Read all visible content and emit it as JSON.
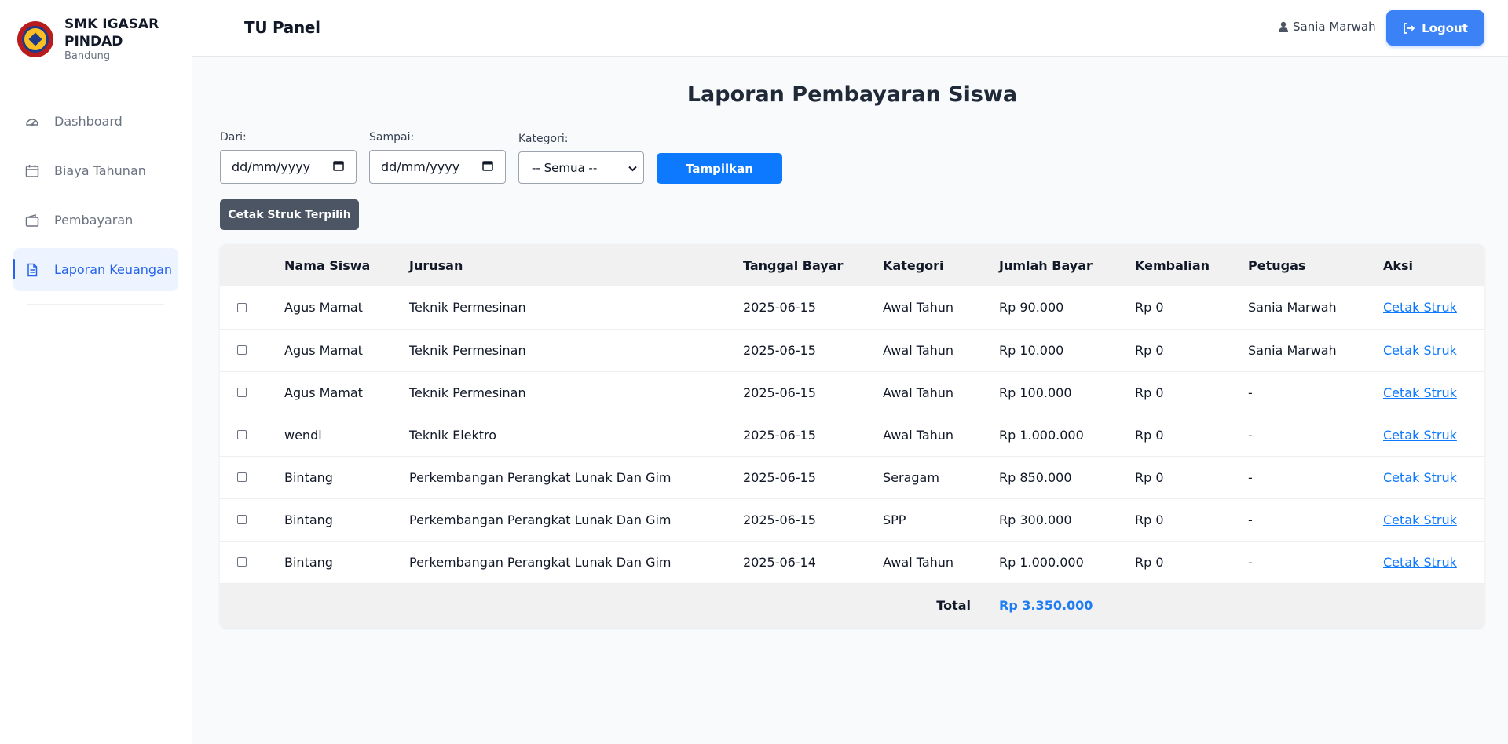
{
  "brand": {
    "name": "SMK IGASAR PINDAD",
    "city": "Bandung"
  },
  "sidebar": {
    "items": [
      {
        "label": "Dashboard",
        "icon": "gauge-icon",
        "active": false
      },
      {
        "label": "Biaya Tahunan",
        "icon": "calendar-icon",
        "active": false
      },
      {
        "label": "Pembayaran",
        "icon": "wallet-icon",
        "active": false
      },
      {
        "label": "Laporan Keuangan",
        "icon": "document-icon",
        "active": true
      }
    ]
  },
  "header": {
    "title": "TU Panel",
    "user_name": "Sania Marwah",
    "logout_label": "Logout"
  },
  "main": {
    "title": "Laporan Pembayaran Siswa",
    "filters": {
      "from_label": "Dari:",
      "from_value": "dd/mm/yyyy",
      "to_label": "Sampai:",
      "to_value": "dd/mm/yyyy",
      "category_label": "Kategori:",
      "category_value": "-- Semua --",
      "submit_label": "Tampilkan"
    },
    "print_selected_label": "Cetak Struk Terpilih"
  },
  "table": {
    "headers": [
      "",
      "Nama Siswa",
      "Jurusan",
      "Tanggal Bayar",
      "Kategori",
      "Jumlah Bayar",
      "Kembalian",
      "Petugas",
      "Aksi"
    ],
    "rows": [
      {
        "nama": "Agus Mamat",
        "jurusan": "Teknik Permesinan",
        "tanggal": "2025-06-15",
        "kategori": "Awal Tahun",
        "jumlah": "Rp 90.000",
        "kembalian": "Rp 0",
        "petugas": "Sania Marwah",
        "aksi": "Cetak Struk"
      },
      {
        "nama": "Agus Mamat",
        "jurusan": "Teknik Permesinan",
        "tanggal": "2025-06-15",
        "kategori": "Awal Tahun",
        "jumlah": "Rp 10.000",
        "kembalian": "Rp 0",
        "petugas": "Sania Marwah",
        "aksi": "Cetak Struk"
      },
      {
        "nama": "Agus Mamat",
        "jurusan": "Teknik Permesinan",
        "tanggal": "2025-06-15",
        "kategori": "Awal Tahun",
        "jumlah": "Rp 100.000",
        "kembalian": "Rp 0",
        "petugas": "-",
        "aksi": "Cetak Struk"
      },
      {
        "nama": "wendi",
        "jurusan": "Teknik Elektro",
        "tanggal": "2025-06-15",
        "kategori": "Awal Tahun",
        "jumlah": "Rp 1.000.000",
        "kembalian": "Rp 0",
        "petugas": "-",
        "aksi": "Cetak Struk"
      },
      {
        "nama": "Bintang",
        "jurusan": "Perkembangan Perangkat Lunak Dan Gim",
        "tanggal": "2025-06-15",
        "kategori": "Seragam",
        "jumlah": "Rp 850.000",
        "kembalian": "Rp 0",
        "petugas": "-",
        "aksi": "Cetak Struk"
      },
      {
        "nama": "Bintang",
        "jurusan": "Perkembangan Perangkat Lunak Dan Gim",
        "tanggal": "2025-06-15",
        "kategori": "SPP",
        "jumlah": "Rp 300.000",
        "kembalian": "Rp 0",
        "petugas": "-",
        "aksi": "Cetak Struk"
      },
      {
        "nama": "Bintang",
        "jurusan": "Perkembangan Perangkat Lunak Dan Gim",
        "tanggal": "2025-06-14",
        "kategori": "Awal Tahun",
        "jumlah": "Rp 1.000.000",
        "kembalian": "Rp 0",
        "petugas": "-",
        "aksi": "Cetak Struk"
      }
    ],
    "total_label": "Total",
    "total_value": "Rp 3.350.000"
  },
  "colors": {
    "accent": "#3b82f6",
    "primary_button": "#0d79ff",
    "dark_button": "#4b5563",
    "total_value": "#1d7cf2"
  }
}
